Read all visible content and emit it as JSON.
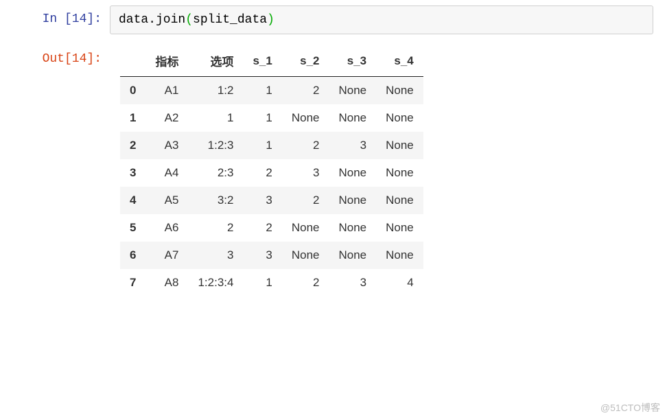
{
  "cell": {
    "in_prompt": "In [14]:",
    "out_prompt": "Out[14]:",
    "code_prefix": "data.join",
    "code_paren_open": "(",
    "code_arg": "split_data",
    "code_paren_close": ")"
  },
  "table": {
    "columns": [
      "指标",
      "选项",
      "s_1",
      "s_2",
      "s_3",
      "s_4"
    ],
    "index": [
      "0",
      "1",
      "2",
      "3",
      "4",
      "5",
      "6",
      "7"
    ],
    "rows": [
      [
        "A1",
        "1:2",
        "1",
        "2",
        "None",
        "None"
      ],
      [
        "A2",
        "1",
        "1",
        "None",
        "None",
        "None"
      ],
      [
        "A3",
        "1:2:3",
        "1",
        "2",
        "3",
        "None"
      ],
      [
        "A4",
        "2:3",
        "2",
        "3",
        "None",
        "None"
      ],
      [
        "A5",
        "3:2",
        "3",
        "2",
        "None",
        "None"
      ],
      [
        "A6",
        "2",
        "2",
        "None",
        "None",
        "None"
      ],
      [
        "A7",
        "3",
        "3",
        "None",
        "None",
        "None"
      ],
      [
        "A8",
        "1:2:3:4",
        "1",
        "2",
        "3",
        "4"
      ]
    ]
  },
  "watermark": "@51CTO博客"
}
